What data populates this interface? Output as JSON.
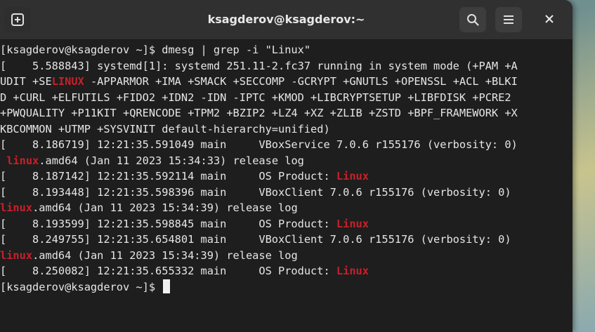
{
  "window": {
    "title": "ksagderov@ksagderov:~",
    "buttons": {
      "new_tab_icon": "new-tab-icon",
      "search_icon": "search-icon",
      "menu_icon": "hamburger-menu-icon",
      "close_icon": "close-icon"
    }
  },
  "colors": {
    "terminal_bg": "#1e1e1e",
    "titlebar_bg": "#303030",
    "text": "#e6e6e6",
    "highlight": "#c8202a"
  },
  "terminal": {
    "lines": [
      [
        {
          "t": "[ksagderov@ksagderov ~]$ dmesg | grep -i \"Linux\""
        }
      ],
      [
        {
          "t": "[    5.588843] systemd[1]: systemd 251.11-2.fc37 running in system mode (+PAM +A"
        }
      ],
      [
        {
          "t": "UDIT +SE"
        },
        {
          "t": "LINUX",
          "h": true
        },
        {
          "t": " -APPARMOR +IMA +SMACK +SECCOMP -GCRYPT +GNUTLS +OPENSSL +ACL +BLKI"
        }
      ],
      [
        {
          "t": "D +CURL +ELFUTILS +FIDO2 +IDN2 -IDN -IPTC +KMOD +LIBCRYPTSETUP +LIBFDISK +PCRE2"
        }
      ],
      [
        {
          "t": "+PWQUALITY +P11KIT +QRENCODE +TPM2 +BZIP2 +LZ4 +XZ +ZLIB +ZSTD +BPF_FRAMEWORK +X"
        }
      ],
      [
        {
          "t": "KBCOMMON +UTMP +SYSVINIT default-hierarchy=unified)"
        }
      ],
      [
        {
          "t": "[    8.186719] 12:21:35.591049 main     VBoxService 7.0.6 r155176 (verbosity: 0)"
        }
      ],
      [
        {
          "t": " "
        },
        {
          "t": "linux",
          "h": true
        },
        {
          "t": ".amd64 (Jan 11 2023 15:34:33) release log"
        }
      ],
      [
        {
          "t": "[    8.187142] 12:21:35.592114 main     OS Product: "
        },
        {
          "t": "Linux",
          "h": true
        }
      ],
      [
        {
          "t": "[    8.193448] 12:21:35.598396 main     VBoxClient 7.0.6 r155176 (verbosity: 0)"
        }
      ],
      [
        {
          "t": "linux",
          "h": true
        },
        {
          "t": ".amd64 (Jan 11 2023 15:34:39) release log"
        }
      ],
      [
        {
          "t": "[    8.193599] 12:21:35.598845 main     OS Product: "
        },
        {
          "t": "Linux",
          "h": true
        }
      ],
      [
        {
          "t": "[    8.249755] 12:21:35.654801 main     VBoxClient 7.0.6 r155176 (verbosity: 0)"
        }
      ],
      [
        {
          "t": "linux",
          "h": true
        },
        {
          "t": ".amd64 (Jan 11 2023 15:34:39) release log"
        }
      ],
      [
        {
          "t": "[    8.250082] 12:21:35.655332 main     OS Product: "
        },
        {
          "t": "Linux",
          "h": true
        }
      ],
      [
        {
          "t": "[ksagderov@ksagderov ~]$ "
        }
      ]
    ]
  }
}
